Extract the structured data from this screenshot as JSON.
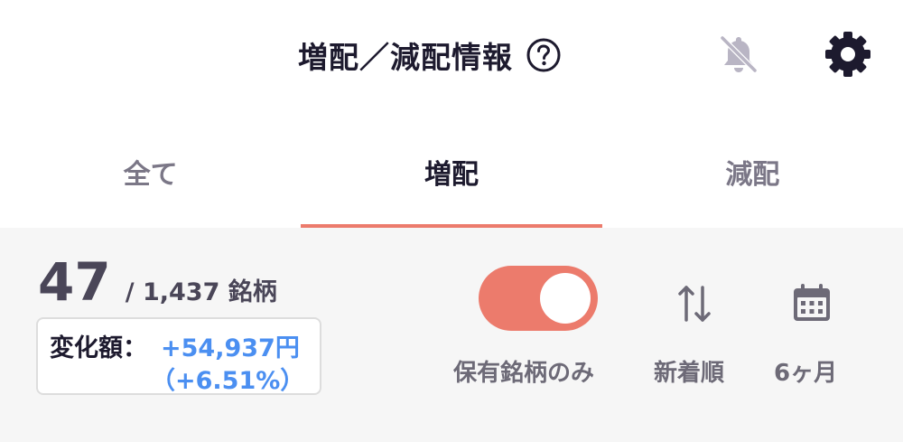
{
  "header": {
    "title": "増配／減配情報",
    "help_icon": "question-circle-icon",
    "bell_icon": "bell-off-icon",
    "settings_icon": "gear-icon"
  },
  "tabs": [
    {
      "label": "全て",
      "active": false
    },
    {
      "label": "増配",
      "active": true
    },
    {
      "label": "減配",
      "active": false
    }
  ],
  "summary": {
    "count": "47",
    "total": "/ 1,437 銘柄",
    "change_label": "変化額：",
    "change_value": "+54,937円",
    "change_percent": "（+6.51%）"
  },
  "controls": {
    "holdings_only_label": "保有銘柄のみ",
    "holdings_only_on": true,
    "sort_label": "新着順",
    "sort_icon": "sort-arrows-icon",
    "period_label": "6ヶ月",
    "period_icon": "calendar-icon"
  },
  "colors": {
    "accent": "#ec7b6c",
    "positive": "#4b8ff1",
    "text_dark": "#1d1a2e",
    "text_muted": "#7b7787",
    "panel_bg": "#f6f6f6"
  }
}
